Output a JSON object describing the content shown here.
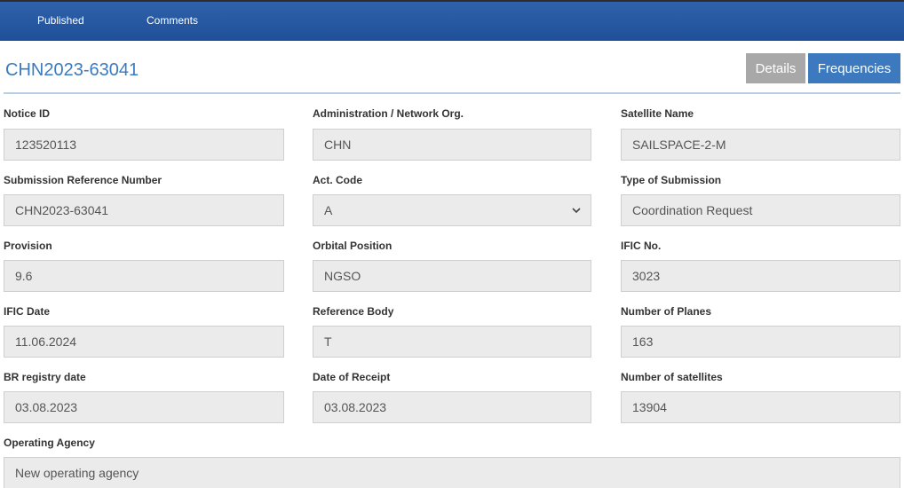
{
  "nav": {
    "tabs": [
      {
        "label": "Published"
      },
      {
        "label": "Comments"
      }
    ]
  },
  "header": {
    "title": "CHN2023-63041",
    "details_label": "Details",
    "frequencies_label": "Frequencies"
  },
  "fields": {
    "notice_id": {
      "label": "Notice ID",
      "value": "123520113"
    },
    "administration": {
      "label": "Administration / Network Org.",
      "value": "CHN"
    },
    "satellite_name": {
      "label": "Satellite Name",
      "value": "SAILSPACE-2-M"
    },
    "submission_ref": {
      "label": "Submission Reference Number",
      "value": "CHN2023-63041"
    },
    "act_code": {
      "label": "Act. Code",
      "value": "A"
    },
    "type_of_submission": {
      "label": "Type of Submission",
      "value": "Coordination Request"
    },
    "provision": {
      "label": "Provision",
      "value": "9.6"
    },
    "orbital_position": {
      "label": "Orbital Position",
      "value": "NGSO"
    },
    "ific_no": {
      "label": "IFIC No.",
      "value": "3023"
    },
    "ific_date": {
      "label": "IFIC Date",
      "value": "11.06.2024"
    },
    "reference_body": {
      "label": "Reference Body",
      "value": "T"
    },
    "number_of_planes": {
      "label": "Number of Planes",
      "value": "163"
    },
    "br_registry_date": {
      "label": "BR registry date",
      "value": "03.08.2023"
    },
    "date_of_receipt": {
      "label": "Date of Receipt",
      "value": "03.08.2023"
    },
    "number_of_satellites": {
      "label": "Number of satellites",
      "value": "13904"
    },
    "operating_agency": {
      "label": "Operating Agency",
      "value": "New operating agency"
    }
  },
  "colors": {
    "nav_bar": "#1f4f99",
    "accent": "#3a7bbf",
    "details_button": "#a8a8a8",
    "frequencies_button": "#3c79be",
    "field_background": "#ebebeb"
  },
  "icons": {
    "act_code_select": "chevron-down-icon"
  }
}
